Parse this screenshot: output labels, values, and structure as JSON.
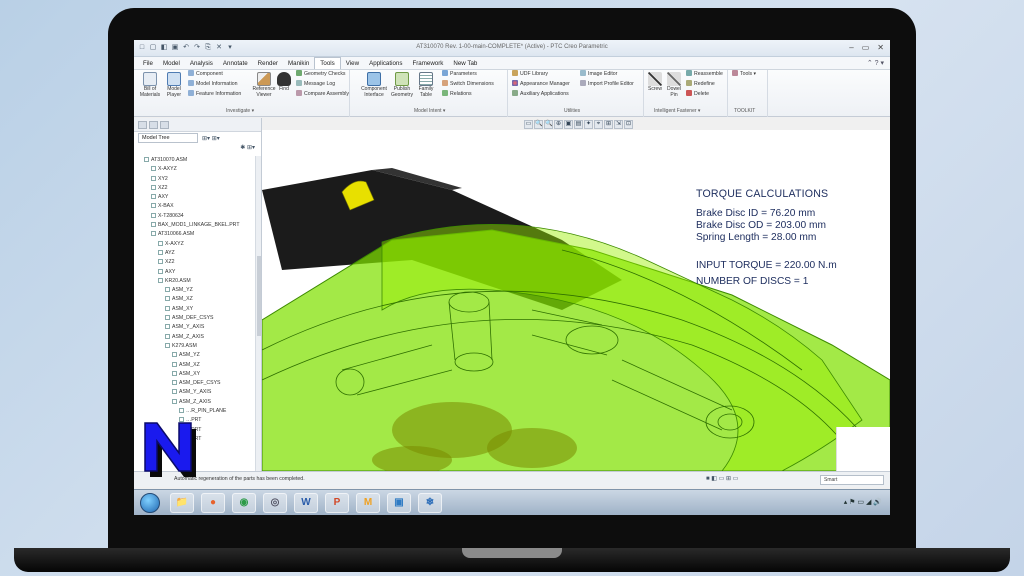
{
  "window": {
    "title": "AT310070 Rev. 1-00-main-COMPLETE* (Active) - PTC Creo Parametric",
    "quick_access": [
      "□",
      "▢",
      "◧",
      "▣",
      "↶",
      "↷",
      "⎘",
      "✕",
      "▾"
    ],
    "controls": [
      "–",
      "▭",
      "✕"
    ]
  },
  "menu": {
    "tabs": [
      "File",
      "Model",
      "Analysis",
      "Annotate",
      "Render",
      "Manikin",
      "Tools",
      "View",
      "Applications",
      "Framework",
      "New Tab"
    ],
    "active_tab": "Tools",
    "help_icons": "⌃ ? ▾"
  },
  "ribbon": {
    "investigate": {
      "label": "Investigate ▾",
      "bill_of_materials": "Bill of Materials",
      "model_player": "Model Player",
      "component": "Component",
      "model_information": "Model Information",
      "feature_information": "Feature Information",
      "reference_viewer": "Reference Viewer",
      "find": "Find",
      "geometry_checks": "Geometry Checks",
      "message_log": "Message Log",
      "compare_assembly": "Compare Assembly"
    },
    "model_intent": {
      "label": "Model Intent ▾",
      "component_interface": "Component Interface",
      "publish_geometry": "Publish Geometry",
      "family_table": "Family Table",
      "parameters": "Parameters",
      "switch_dimensions": "Switch Dimensions",
      "relations": "Relations"
    },
    "utilities": {
      "label": "Utilities",
      "udf_library": "UDF Library",
      "appearance_manager": "Appearance Manager",
      "auxiliary_applications": "Auxiliary Applications",
      "image_editor": "Image Editor",
      "import_profile_editor": "Import Profile Editor"
    },
    "intelligent_fastener": {
      "label": "Intelligent Fastener ▾",
      "screw": "Screw",
      "dowel_pin": "Dowel Pin",
      "reassemble": "Reassemble",
      "redefine": "Redefine",
      "delete": "Delete"
    },
    "toolkit": {
      "label": "TOOLKIT",
      "tools": "Tools ▾"
    }
  },
  "graphics_toolbar": [
    "▭",
    "🔍",
    "🔍",
    "⊕",
    "▣",
    "▤",
    "✦",
    "⌖",
    "⊞",
    "⇲",
    "⊡"
  ],
  "left_panel": {
    "tree_selector": "Model Tree",
    "tree_tools": "⊞▾ ⊞▾",
    "tree_tools2": "✱ ⊞▾",
    "items": [
      {
        "label": "AT310070.ASM",
        "indent": 0
      },
      {
        "label": "X-AXYZ",
        "indent": 1
      },
      {
        "label": "XY2",
        "indent": 1
      },
      {
        "label": "XZ2",
        "indent": 1
      },
      {
        "label": "AXY",
        "indent": 1
      },
      {
        "label": "X-BAX",
        "indent": 1
      },
      {
        "label": "X-T280634",
        "indent": 1
      },
      {
        "label": "BAX_MOD1_LINKAGE_BKEL.PRT",
        "indent": 1
      },
      {
        "label": "AT310066.ASM",
        "indent": 1
      },
      {
        "label": "X-AXYZ",
        "indent": 2
      },
      {
        "label": "AYZ",
        "indent": 2
      },
      {
        "label": "XZ2",
        "indent": 2
      },
      {
        "label": "AXY",
        "indent": 2
      },
      {
        "label": "KR20.ASM",
        "indent": 2
      },
      {
        "label": "ASM_YZ",
        "indent": 3
      },
      {
        "label": "ASM_XZ",
        "indent": 3
      },
      {
        "label": "ASM_XY",
        "indent": 3
      },
      {
        "label": "ASM_DEF_CSYS",
        "indent": 3
      },
      {
        "label": "ASM_Y_AXIS",
        "indent": 3
      },
      {
        "label": "ASM_Z_AXIS",
        "indent": 3
      },
      {
        "label": "K279.ASM",
        "indent": 3
      },
      {
        "label": "ASM_YZ",
        "indent": 4
      },
      {
        "label": "ASM_XZ",
        "indent": 4
      },
      {
        "label": "ASM_XY",
        "indent": 4
      },
      {
        "label": "ASM_DEF_CSYS",
        "indent": 4
      },
      {
        "label": "ASM_Y_AXIS",
        "indent": 4
      },
      {
        "label": "ASM_Z_AXIS",
        "indent": 4
      },
      {
        "label": "…R_PIN_PLANE",
        "indent": 5
      },
      {
        "label": "…PRT",
        "indent": 5
      },
      {
        "label": "…PRT",
        "indent": 5
      },
      {
        "label": "…PRT",
        "indent": 5
      }
    ]
  },
  "viewport": {
    "torque_title": "TORQUE CALCULATIONS",
    "brake_disc_id": "Brake Disc ID   = 76.20 mm",
    "brake_disc_od": "Brake Disc OD  = 203.00 mm",
    "spring_length": "Spring Length   = 28.00 mm",
    "input_torque": "INPUT TORQUE = 220.00 N.m",
    "number_of_discs": "NUMBER OF DISCS = 1",
    "colors": {
      "wireframe": "#7fe000",
      "wire_stroke": "#3d8a00",
      "body_dark": "#1b1b1b",
      "yellow": "#e8e000"
    }
  },
  "status": {
    "message": "Automatic regeneration of the parts has been completed.",
    "right_icons": "■ ◧ ▭ ⊞ ▭",
    "filter": "Smart"
  },
  "taskbar": {
    "apps": [
      {
        "name": "explorer",
        "glyph": "📁",
        "color": "#e9b43a"
      },
      {
        "name": "firefox",
        "glyph": "●",
        "color": "#e7622c"
      },
      {
        "name": "chrome",
        "glyph": "◉",
        "color": "#2d9b47"
      },
      {
        "name": "binoculars",
        "glyph": "◎",
        "color": "#556"
      },
      {
        "name": "word",
        "glyph": "W",
        "color": "#2a5caa"
      },
      {
        "name": "powerpoint",
        "glyph": "P",
        "color": "#d24726"
      },
      {
        "name": "mathcad",
        "glyph": "M",
        "color": "#f0a020"
      },
      {
        "name": "screen",
        "glyph": "▣",
        "color": "#2f7bc4"
      },
      {
        "name": "creo",
        "glyph": "❄",
        "color": "#2a6cb8"
      }
    ],
    "tray": "▴ ⚑ ▭ ◢ 🔊"
  }
}
